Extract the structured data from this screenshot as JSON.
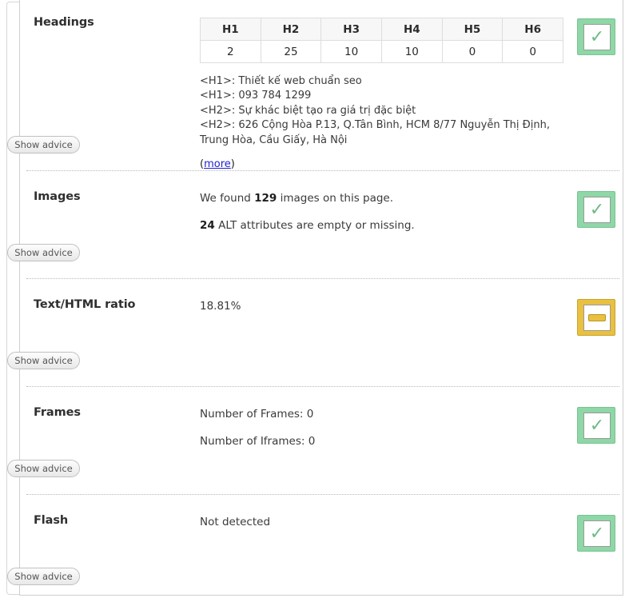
{
  "sections": [
    {
      "id": "headings",
      "title": "Headings",
      "advice_label": "Show advice",
      "status": "ok",
      "status_icon": "check-icon",
      "table": {
        "columns": [
          "H1",
          "H2",
          "H3",
          "H4",
          "H5",
          "H6"
        ],
        "values": [
          "2",
          "25",
          "10",
          "10",
          "0",
          "0"
        ]
      },
      "heading_list": "<H1>: Thiết kế web chuẩn seo\n<H1>: 093 784 1299\n<H2>: Sự khác biệt tạo ra giá trị đặc biệt\n<H2>: 626 Cộng Hòa P.13, Q.Tân Bình, HCM 8/77 Nguyễn Thị Định, Trung Hòa, Cầu Giấy, Hà Nội",
      "more_open": "(",
      "more_label": "more",
      "more_close": ")"
    },
    {
      "id": "images",
      "title": "Images",
      "advice_label": "Show advice",
      "status": "ok",
      "status_icon": "check-icon",
      "line1_pre": "We found ",
      "line1_count": "129",
      "line1_post": " images on this page.",
      "line2_count": "24",
      "line2_post": " ALT attributes are empty or missing."
    },
    {
      "id": "text-html-ratio",
      "title": "Text/HTML ratio",
      "advice_label": "Show advice",
      "status": "warn",
      "status_icon": "dash-icon",
      "value": "18.81%"
    },
    {
      "id": "frames",
      "title": "Frames",
      "advice_label": "Show advice",
      "status": "ok",
      "status_icon": "check-icon",
      "line1": "Number of Frames: 0",
      "line2": "Number of Iframes: 0"
    },
    {
      "id": "flash",
      "title": "Flash",
      "advice_label": "Show advice",
      "status": "ok",
      "status_icon": "check-icon",
      "value": "Not detected"
    }
  ],
  "colors": {
    "ok": "#8ed7a6",
    "warn": "#e9c040",
    "link": "#2222cc"
  }
}
